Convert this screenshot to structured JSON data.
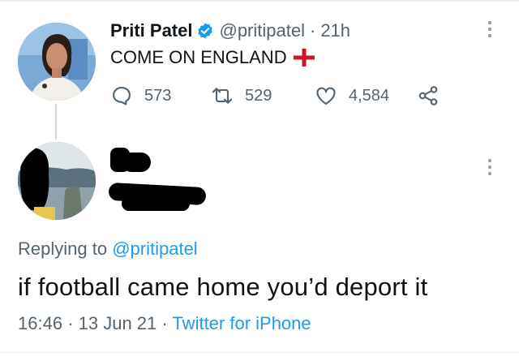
{
  "tweet": {
    "author_name": "Priti Patel",
    "handle": "@pritipatel",
    "separator": "·",
    "time": "21h",
    "text": "COME ON ENGLAND",
    "flag_icon": "england-flag-icon",
    "stats": {
      "replies": "573",
      "retweets": "529",
      "likes": "4,584"
    }
  },
  "reply": {
    "replying_prefix": "Replying to",
    "replying_handle": "@pritipatel",
    "text": "if football came home you’d deport it",
    "time": "16:46",
    "separator": "·",
    "date": "13 Jun 21",
    "separator2": "·",
    "source": "Twitter for iPhone"
  },
  "colors": {
    "link": "#1d9bf0",
    "muted": "#536471",
    "text": "#0f1419",
    "flag_red": "#cf142b"
  }
}
